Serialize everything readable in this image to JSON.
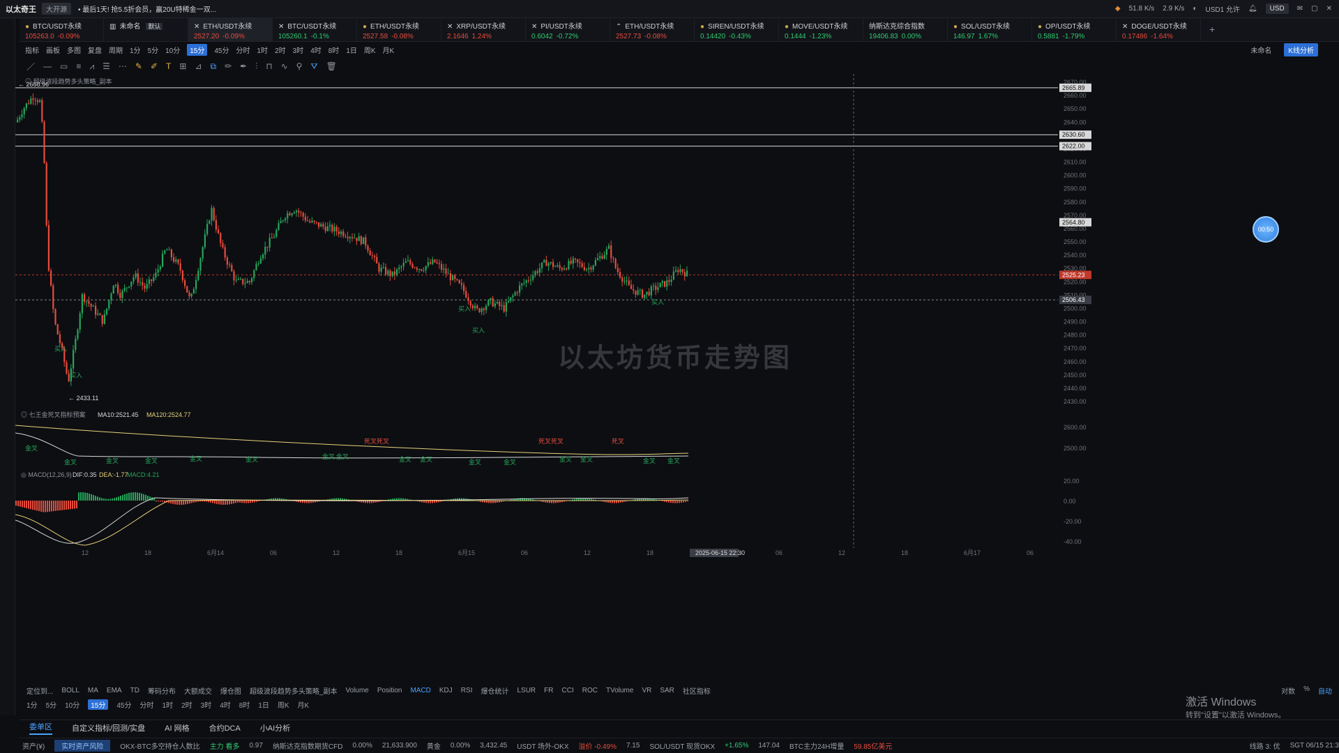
{
  "topbar": {
    "app_name": "以太奇王",
    "badge": "大开源",
    "notice": "• 最后1天! 抢5.5折会员，赢20U特稀金一双...",
    "stat1": "51.8 K/s",
    "stat2": "2.9 K/s",
    "currency": "USD",
    "account": "USD1 允许"
  },
  "tabs": [
    {
      "name": "BTC/USDT永续",
      "price": "105263.0",
      "change": "-0.09%",
      "dir": "dn",
      "icon": "dot"
    },
    {
      "name": "未命名",
      "price": "",
      "change": "",
      "dir": "up",
      "icon": "layout",
      "tag": "默认"
    },
    {
      "name": "ETH/USDT永续",
      "price": "2527.20",
      "change": "-0.09%",
      "dir": "dn",
      "icon": "close",
      "active": true
    },
    {
      "name": "BTC/USDT永续",
      "price": "105260.1",
      "change": "-0.1%",
      "dir": "up",
      "icon": "close"
    },
    {
      "name": "ETH/USDT永续",
      "price": "2527.58",
      "change": "-0.08%",
      "dir": "dn",
      "icon": "dot"
    },
    {
      "name": "XRP/USDT永续",
      "price": "2.1646",
      "change": "1.24%",
      "dir": "dn",
      "icon": "close"
    },
    {
      "name": "PI/USDT永续",
      "price": "0.6042",
      "change": "-0.72%",
      "dir": "up",
      "icon": "close"
    },
    {
      "name": "ETH/USDT永续",
      "price": "2527.73",
      "change": "-0.08%",
      "dir": "dn",
      "icon": "up"
    },
    {
      "name": "SIREN/USDT永续",
      "price": "0.14420",
      "change": "-0.43%",
      "dir": "up",
      "icon": "dot"
    },
    {
      "name": "MOVE/USDT永续",
      "price": "0.1444",
      "change": "-1.23%",
      "dir": "up",
      "icon": "dot"
    },
    {
      "name": "纳斯达克综合指数",
      "price": "19406.83",
      "change": "0.00%",
      "dir": "up",
      "icon": "none"
    },
    {
      "name": "SOL/USDT永续",
      "price": "146.97",
      "change": "1.67%",
      "dir": "up",
      "icon": "dot"
    },
    {
      "name": "OP/USDT永续",
      "price": "0.5881",
      "change": "-1.79%",
      "dir": "up",
      "icon": "dot"
    },
    {
      "name": "DOGE/USDT永续",
      "price": "0.17486",
      "change": "-1.64%",
      "dir": "dn",
      "icon": "close"
    }
  ],
  "toolbar1": {
    "items": [
      "指标",
      "画板",
      "多图",
      "复盘",
      "周期",
      "1分",
      "5分",
      "10分",
      "15分",
      "45分",
      "分时",
      "1时",
      "2时",
      "3时",
      "4时",
      "8时",
      "1日",
      "周K",
      "月K"
    ],
    "selected": "15分",
    "right_label": "未命名",
    "k_button": "K线分析"
  },
  "overlay_title": "以太坊货币走势图",
  "float_button": "00:50",
  "main_chart": {
    "strategy_label": "超级波段趋势多头策略_副本",
    "high_label": "2668.96",
    "low_label": "2433.11",
    "price_ticks": [
      "2670.00",
      "2660.00",
      "2650.00",
      "2640.00",
      "2630.00",
      "2620.00",
      "2610.00",
      "2600.00",
      "2590.00",
      "2580.00",
      "2570.00",
      "2560.00",
      "2550.00",
      "2540.00",
      "2530.00",
      "2520.00",
      "2510.00",
      "2500.00",
      "2490.00",
      "2480.00",
      "2470.00",
      "2460.00",
      "2450.00",
      "2440.00",
      "2430.00"
    ],
    "hline_tags": [
      "2665.89",
      "2630.60",
      "2622.00",
      "2564.80",
      "2525.23",
      "2506.43"
    ],
    "time_labels": [
      "12",
      "18",
      "6月14",
      "06",
      "12",
      "18",
      "6月15",
      "06",
      "12",
      "18",
      "2025-06-15 22:30",
      "06",
      "12",
      "18",
      "6月17",
      "06"
    ],
    "buy_label": "买入"
  },
  "ma_panel": {
    "title": "七王金死叉指标预案",
    "ma10": "MA10:2521.45",
    "ma120": "MA120:2524.77",
    "ticks": [
      "2600.00",
      "2500.00"
    ],
    "golden": "金叉",
    "death": "死叉",
    "markers_red": [
      "死叉死叉",
      "死叉死叉",
      "死叉"
    ]
  },
  "macd_panel": {
    "title": "MACD(12,26,9)",
    "dif": "DIF:0.35",
    "dea": "DEA:-1.77",
    "macd": "MACD:4.21",
    "ticks": [
      "20.00",
      "0.00",
      "-20.00",
      "-40.00"
    ]
  },
  "indicator_row": [
    "定位到...",
    "BOLL",
    "MA",
    "EMA",
    "TD",
    "筹码分布",
    "大额成交",
    "爆仓图",
    "超级波段趋势多头策略_副本",
    "Volume",
    "Position",
    "MACD",
    "KDJ",
    "RSI",
    "爆仓统计",
    "LSUR",
    "FR",
    "CCI",
    "ROC",
    "TVolume",
    "VR",
    "SAR",
    "社区指标"
  ],
  "indicator_active": "MACD",
  "indicator_right": [
    "对数",
    "%",
    "自动"
  ],
  "period_row": [
    "1分",
    "5分",
    "10分",
    "15分",
    "45分",
    "分时",
    "1时",
    "2时",
    "3时",
    "4时",
    "8时",
    "1日",
    "周K",
    "月K"
  ],
  "period_selected": "15分",
  "bottom_tabs": [
    "委单区",
    "自定义指标/回测/实盘",
    "AI 网格",
    "合约DCA",
    "小AI分析"
  ],
  "bottom_active": "委单区",
  "status": {
    "asset": "资产(¥)",
    "realtime": "实时资产风险",
    "ticker1": "OKX-BTC多空持仓人数比",
    "t1_tag": "主力 看多",
    "t1_val": "0.97",
    "ticker2": "纳斯达克指数期货CFD",
    "t2_chg": "0.00%",
    "t2_val": "21,633.900",
    "ticker3": "黄金",
    "t3_chg": "0.00%",
    "t3_val": "3,432.45",
    "ticker4": "USDT 场外-OKX",
    "t4_tag": "溢价 -0.49%",
    "t4_val": "7.15",
    "ticker5": "SOL/USDT 现货OKX",
    "t5_chg": "+1.65%",
    "t5_val": "147.04",
    "ticker6": "BTC主力24H增量",
    "t6_val": "59.85亿美元",
    "net": "线路 3: 优",
    "time": "SGT 06/15 21:3"
  },
  "watermark": {
    "line1": "激活 Windows",
    "line2": "转到\"设置\"以激活 Windows。"
  },
  "colors": {
    "up": "#2ecc71",
    "down": "#e74c3c",
    "accent": "#2c6fd6",
    "ma_yellow": "#e6d27a",
    "ma_white": "#d9d9d9"
  }
}
